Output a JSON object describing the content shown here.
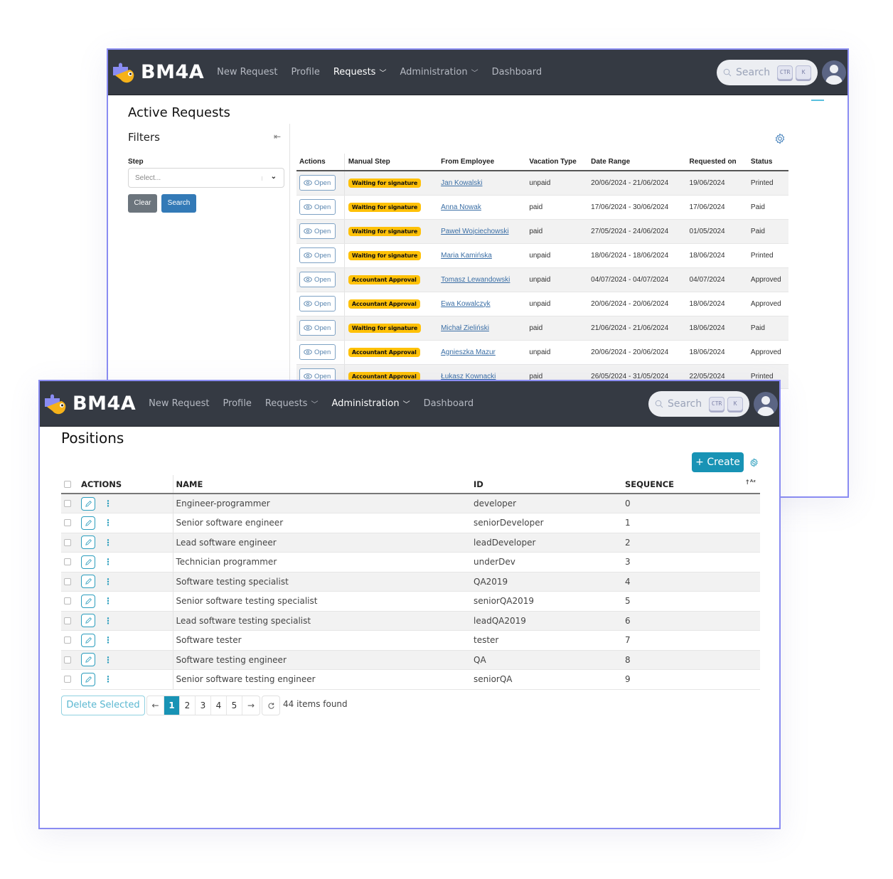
{
  "back_window": {
    "brand": "BM4A",
    "nav": [
      {
        "label": "New Request",
        "dropdown": false,
        "active": false
      },
      {
        "label": "Profile",
        "dropdown": false,
        "active": false
      },
      {
        "label": "Requests",
        "dropdown": true,
        "active": true
      },
      {
        "label": "Administration",
        "dropdown": true,
        "active": false
      },
      {
        "label": "Dashboard",
        "dropdown": false,
        "active": false
      }
    ],
    "search": {
      "placeholder": "Search",
      "key1": "CTR",
      "key2": "K"
    },
    "page_title": "Active Requests",
    "filters": {
      "title": "Filters",
      "step_label": "Step",
      "step_placeholder": "Select...",
      "clear_label": "Clear",
      "search_label": "Search"
    },
    "table": {
      "headers": [
        "Actions",
        "Manual Step",
        "From Employee",
        "Vacation Type",
        "Date Range",
        "Requested on",
        "Status"
      ],
      "open_label": "Open",
      "rows": [
        {
          "step": "Waiting for signature",
          "employee": "Jan Kowalski",
          "type": "unpaid",
          "range": "20/06/2024 - 21/06/2024",
          "requested": "19/06/2024",
          "status": "Printed"
        },
        {
          "step": "Waiting for signature",
          "employee": "Anna Nowak",
          "type": "paid",
          "range": "17/06/2024 - 30/06/2024",
          "requested": "17/06/2024",
          "status": "Paid"
        },
        {
          "step": "Waiting for signature",
          "employee": "Paweł Wojciechowski",
          "type": "paid",
          "range": "27/05/2024 - 24/06/2024",
          "requested": "01/05/2024",
          "status": "Paid"
        },
        {
          "step": "Waiting for signature",
          "employee": "Maria Kamińska",
          "type": "unpaid",
          "range": "18/06/2024 - 18/06/2024",
          "requested": "18/06/2024",
          "status": "Printed"
        },
        {
          "step": "Accountant Approval",
          "employee": "Tomasz Lewandowski",
          "type": "unpaid",
          "range": "04/07/2024 - 04/07/2024",
          "requested": "04/07/2024",
          "status": "Approved"
        },
        {
          "step": "Accountant Approval",
          "employee": "Ewa Kowalczyk",
          "type": "unpaid",
          "range": "20/06/2024 - 20/06/2024",
          "requested": "18/06/2024",
          "status": "Approved"
        },
        {
          "step": "Waiting for signature",
          "employee": "Michał Zieliński",
          "type": "paid",
          "range": "21/06/2024 - 21/06/2024",
          "requested": "18/06/2024",
          "status": "Paid"
        },
        {
          "step": "Accountant Approval",
          "employee": "Agnieszka Mazur",
          "type": "unpaid",
          "range": "20/06/2024 - 20/06/2024",
          "requested": "18/06/2024",
          "status": "Approved"
        },
        {
          "step": "Accountant Approval",
          "employee": "Łukasz Kownacki",
          "type": "paid",
          "range": "26/05/2024 - 31/05/2024",
          "requested": "22/05/2024",
          "status": "Printed"
        }
      ]
    }
  },
  "front_window": {
    "brand": "BM4A",
    "nav": [
      {
        "label": "New Request",
        "dropdown": false,
        "active": false
      },
      {
        "label": "Profile",
        "dropdown": false,
        "active": false
      },
      {
        "label": "Requests",
        "dropdown": true,
        "active": false
      },
      {
        "label": "Administration",
        "dropdown": true,
        "active": true
      },
      {
        "label": "Dashboard",
        "dropdown": false,
        "active": false
      }
    ],
    "search": {
      "placeholder": "Search",
      "key1": "CTR",
      "key2": "K"
    },
    "page_title": "Positions",
    "create_label": "+ Create",
    "table": {
      "headers": {
        "actions": "ACTIONS",
        "name": "NAME",
        "id": "ID",
        "sequence": "SEQUENCE"
      },
      "rows": [
        {
          "name": "Engineer-programmer",
          "id": "developer",
          "sequence": "0"
        },
        {
          "name": "Senior software engineer",
          "id": "seniorDeveloper",
          "sequence": "1"
        },
        {
          "name": "Lead software engineer",
          "id": "leadDeveloper",
          "sequence": "2"
        },
        {
          "name": "Technician programmer",
          "id": "underDev",
          "sequence": "3"
        },
        {
          "name": "Software testing specialist",
          "id": "QA2019",
          "sequence": "4"
        },
        {
          "name": "Senior software testing specialist",
          "id": "seniorQA2019",
          "sequence": "5"
        },
        {
          "name": "Lead software testing specialist",
          "id": "leadQA2019",
          "sequence": "6"
        },
        {
          "name": "Software tester",
          "id": "tester",
          "sequence": "7"
        },
        {
          "name": "Software testing engineer",
          "id": "QA",
          "sequence": "8"
        },
        {
          "name": "Senior software testing engineer",
          "id": "seniorQA",
          "sequence": "9"
        }
      ]
    },
    "delete_selected_label": "Delete Selected",
    "pagination": {
      "prev": "←",
      "next": "→",
      "pages": [
        "1",
        "2",
        "3",
        "4",
        "5"
      ],
      "current": "1"
    },
    "items_found": "44 items found"
  },
  "colors": {
    "navbar": "#353a43",
    "accent_teal": "#1893b5",
    "badge_yellow": "#ffc107",
    "window_border": "#8a8cf2",
    "link_blue": "#3a6ea5"
  }
}
